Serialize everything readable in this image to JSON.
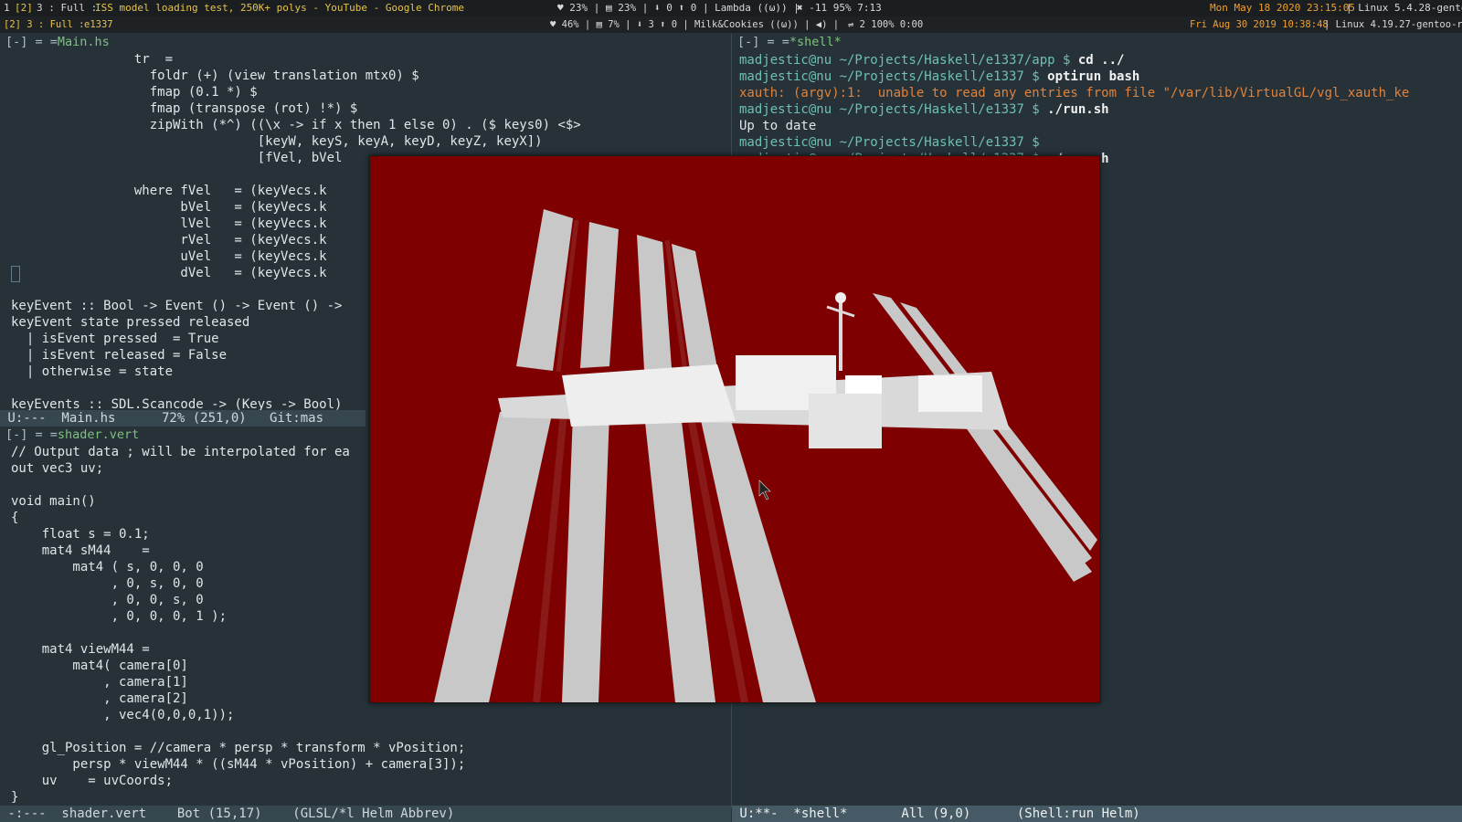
{
  "topbar": {
    "workspace": "1",
    "workspace_sel": "[2]",
    "layout": "3 : Full :",
    "window_title": "ISS model loading test, 250K+ polys - YouTube - Google Chrome",
    "status": "♥ 23%  |  ▤ 23%  |  ⬇ 0  ⬆ 0  |  Lambda  ((ω))  |",
    "vol": "✖ -11 95% 7:13",
    "datetime": "Mon May 18 2020 23:15:05",
    "kernel": "| Linux 5.4.28-gentoo"
  },
  "subbar": {
    "workspace": "[2] 3 : Full :",
    "window_title": "e1337",
    "status": "♥ 46%  |  ▤ 7%  |  ⬇ 3  ⬆ 0  |  Milk&Cookies  ((ω))  |  ◀)  |",
    "extra": "⇌ 2 100% 0:00",
    "datetime": "Fri Aug 30 2019 10:38:48",
    "kernel": "| Linux 4.19.27-gentoo-r"
  },
  "left_top": {
    "title_prefix": "[-] = =",
    "filename": "Main.hs",
    "lines": [
      "                tr  =",
      "                  foldr (+) (view translation mtx0) $",
      "                  fmap (0.1 *) $",
      "                  fmap (transpose (rot) !*) $",
      "                  zipWith (*^) ((\\x -> if x then 1 else 0) . ($ keys0) <$>",
      "                                [keyW, keyS, keyA, keyD, keyZ, keyX])",
      "                                [fVel, bVel",
      "",
      "                where fVel   = (keyVecs.k",
      "                      bVel   = (keyVecs.k",
      "                      lVel   = (keyVecs.k",
      "                      rVel   = (keyVecs.k",
      "                      uVel   = (keyVecs.k",
      "                      dVel   = (keyVecs.k",
      "",
      "keyEvent :: Bool -> Event () -> Event () ->",
      "keyEvent state pressed released",
      "  | isEvent pressed  = True",
      "  | isEvent released = False",
      "  | otherwise = state",
      "",
      "keyEvents :: SDL.Scancode -> (Keys -> Bool)"
    ],
    "modeline": " U:---  Main.hs      72% (251,0)   Git:mas"
  },
  "left_bot": {
    "title_prefix": "[-] = =",
    "filename": "shader.vert",
    "lines": [
      "// Output data ; will be interpolated for ea",
      "out vec3 uv;",
      "",
      "void main()",
      "{",
      "    float s = 0.1;",
      "    mat4 sM44    =",
      "        mat4 ( s, 0, 0, 0",
      "             , 0, s, 0, 0",
      "             , 0, 0, s, 0",
      "             , 0, 0, 0, 1 );",
      "",
      "    mat4 viewM44 =",
      "        mat4( camera[0]",
      "            , camera[1]",
      "            , camera[2]",
      "            , vec4(0,0,0,1));",
      "",
      "    gl_Position = //camera * persp * transform * vPosition;",
      "        persp * viewM44 * ((sM44 * vPosition) + camera[3]);",
      "    uv    = uvCoords;",
      "}"
    ],
    "modeline": " -:---  shader.vert    Bot (15,17)    (GLSL/*l Helm Abbrev)"
  },
  "right": {
    "title_prefix": "[-] = =",
    "filename": "*shell*",
    "lines": [
      {
        "prompt": "madjestic@nu ~/Projects/Haskell/e1337/app $ ",
        "cmd": "cd ../",
        "kind": "prompt"
      },
      {
        "prompt": "madjestic@nu ~/Projects/Haskell/e1337 $ ",
        "cmd": "optirun bash",
        "kind": "prompt"
      },
      {
        "prompt": "",
        "cmd": "xauth: (argv):1:  unable to read any entries from file \"/var/lib/VirtualGL/vgl_xauth_ke",
        "kind": "err"
      },
      {
        "prompt": "madjestic@nu ~/Projects/Haskell/e1337 $ ",
        "cmd": "./run.sh",
        "kind": "prompt"
      },
      {
        "prompt": "",
        "cmd": "Up to date",
        "kind": "out"
      },
      {
        "prompt": "madjestic@nu ~/Projects/Haskell/e1337 $ ",
        "cmd": "",
        "kind": "prompt"
      },
      {
        "prompt": "madjestic@nu ~/Projects/Haskell/e1337 $ ",
        "cmd": "./run.sh",
        "kind": "prompt"
      }
    ],
    "modeline": " U:**-  *shell*       All (9,0)      (Shell:run Helm)"
  },
  "render": {
    "background": "#7f0000",
    "panel": "#c8c8c8"
  }
}
